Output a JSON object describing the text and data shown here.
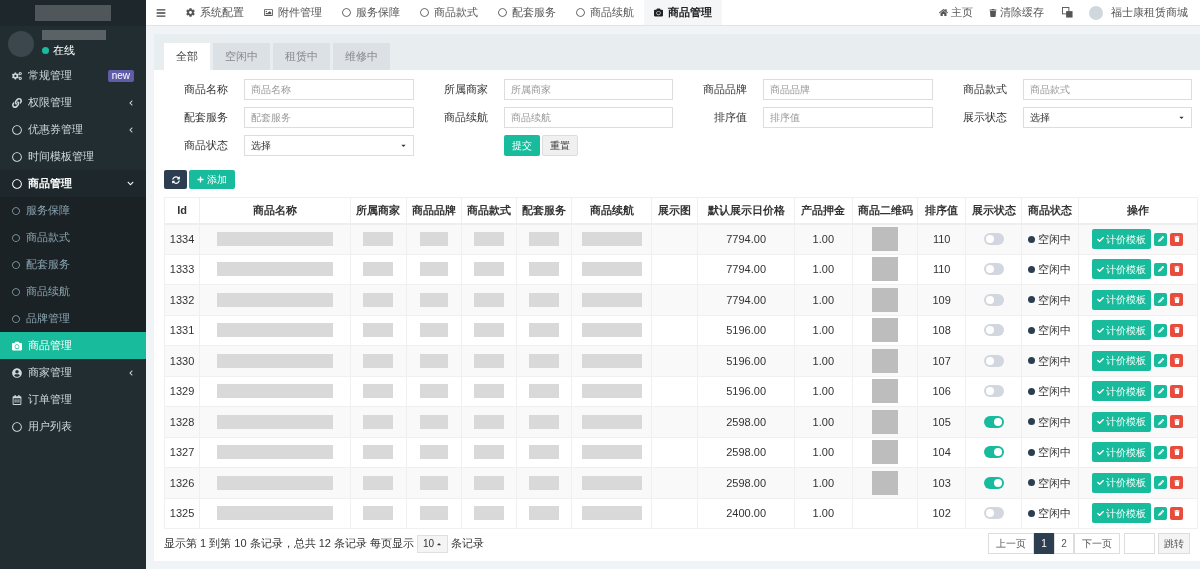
{
  "sidebar": {
    "user_status": "在线",
    "items": [
      {
        "label": "常规管理",
        "badge": "new",
        "arrow": false,
        "selected": false
      },
      {
        "label": "权限管理",
        "arrow": true,
        "selected": false
      },
      {
        "label": "优惠券管理",
        "arrow": true,
        "selected": false
      },
      {
        "label": "时间模板管理",
        "arrow": false,
        "selected": false
      },
      {
        "label": "商品管理",
        "arrow": true,
        "expanded": true,
        "selected": false,
        "children": [
          {
            "label": "服务保障",
            "selected": false
          },
          {
            "label": "商品款式",
            "selected": false
          },
          {
            "label": "配套服务",
            "selected": false
          },
          {
            "label": "商品续航",
            "selected": false
          },
          {
            "label": "品牌管理",
            "selected": false
          }
        ]
      },
      {
        "label": "商品管理",
        "arrow": false,
        "selected": true
      },
      {
        "label": "商家管理",
        "arrow": true,
        "selected": false
      },
      {
        "label": "订单管理",
        "arrow": false,
        "selected": false
      },
      {
        "label": "用户列表",
        "arrow": false,
        "selected": false
      }
    ]
  },
  "top_tabs": [
    {
      "label": "系统配置",
      "selected": false
    },
    {
      "label": "附件管理",
      "selected": false
    },
    {
      "label": "服务保障",
      "selected": false
    },
    {
      "label": "商品款式",
      "selected": false
    },
    {
      "label": "配套服务",
      "selected": false
    },
    {
      "label": "商品续航",
      "selected": false
    },
    {
      "label": "商品管理",
      "selected": true
    }
  ],
  "top_right": {
    "home": "主页",
    "clear_cache": "清除缓存",
    "shop_name": "福士康租赁商城"
  },
  "status_tabs": [
    {
      "label": "全部",
      "selected": true
    },
    {
      "label": "空闲中",
      "selected": false
    },
    {
      "label": "租赁中",
      "selected": false
    },
    {
      "label": "维修中",
      "selected": false
    }
  ],
  "filters": [
    {
      "label": "商品名称",
      "kind": "input",
      "placeholder": "商品名称"
    },
    {
      "label": "所属商家",
      "kind": "input",
      "placeholder": "所属商家"
    },
    {
      "label": "商品品牌",
      "kind": "input",
      "placeholder": "商品品牌"
    },
    {
      "label": "商品款式",
      "kind": "input",
      "placeholder": "商品款式"
    },
    {
      "label": "配套服务",
      "kind": "input",
      "placeholder": "配套服务"
    },
    {
      "label": "商品续航",
      "kind": "input",
      "placeholder": "商品续航"
    },
    {
      "label": "排序值",
      "kind": "input",
      "placeholder": "排序值"
    },
    {
      "label": "展示状态",
      "kind": "select",
      "value": "选择"
    },
    {
      "label": "商品状态",
      "kind": "select",
      "value": "选择"
    }
  ],
  "filter_buttons": {
    "submit": "提交",
    "reset": "重置"
  },
  "toolbar": {
    "add": "添加"
  },
  "table": {
    "columns": [
      "Id",
      "商品名称",
      "所属商家",
      "商品品牌",
      "商品款式",
      "配套服务",
      "商品续航",
      "展示图",
      "默认展示日价格",
      "产品押金",
      "商品二维码",
      "排序值",
      "展示状态",
      "商品状态",
      "操作"
    ],
    "rows": [
      {
        "id": "1334",
        "price": "7794.00",
        "deposit": "1.00",
        "qr": true,
        "sort": "110",
        "display_on": false,
        "status": "空闲中",
        "action": "计价模板"
      },
      {
        "id": "1333",
        "price": "7794.00",
        "deposit": "1.00",
        "qr": true,
        "sort": "110",
        "display_on": false,
        "status": "空闲中",
        "action": "计价模板"
      },
      {
        "id": "1332",
        "price": "7794.00",
        "deposit": "1.00",
        "qr": true,
        "sort": "109",
        "display_on": false,
        "status": "空闲中",
        "action": "计价模板"
      },
      {
        "id": "1331",
        "price": "5196.00",
        "deposit": "1.00",
        "qr": true,
        "sort": "108",
        "display_on": false,
        "status": "空闲中",
        "action": "计价模板"
      },
      {
        "id": "1330",
        "price": "5196.00",
        "deposit": "1.00",
        "qr": true,
        "sort": "107",
        "display_on": false,
        "status": "空闲中",
        "action": "计价模板"
      },
      {
        "id": "1329",
        "price": "5196.00",
        "deposit": "1.00",
        "qr": true,
        "sort": "106",
        "display_on": false,
        "status": "空闲中",
        "action": "计价模板"
      },
      {
        "id": "1328",
        "price": "2598.00",
        "deposit": "1.00",
        "qr": true,
        "sort": "105",
        "display_on": true,
        "status": "空闲中",
        "action": "计价模板"
      },
      {
        "id": "1327",
        "price": "2598.00",
        "deposit": "1.00",
        "qr": true,
        "sort": "104",
        "display_on": true,
        "status": "空闲中",
        "action": "计价模板"
      },
      {
        "id": "1326",
        "price": "2598.00",
        "deposit": "1.00",
        "qr": true,
        "sort": "103",
        "display_on": true,
        "status": "空闲中",
        "action": "计价模板"
      },
      {
        "id": "1325",
        "price": "2400.00",
        "deposit": "1.00",
        "qr": false,
        "sort": "102",
        "display_on": false,
        "status": "空闲中",
        "action": "计价模板"
      }
    ]
  },
  "footer": {
    "summary": "显示第 1 到第 10 条记录，总共 12 条记录 每页显示",
    "page_size": "10",
    "suffix": "条记录"
  },
  "pagination": {
    "prev": "上一页",
    "pages": [
      {
        "label": "1",
        "selected": true
      },
      {
        "label": "2",
        "selected": false
      }
    ],
    "next": "下一页",
    "jump": "跳转"
  }
}
